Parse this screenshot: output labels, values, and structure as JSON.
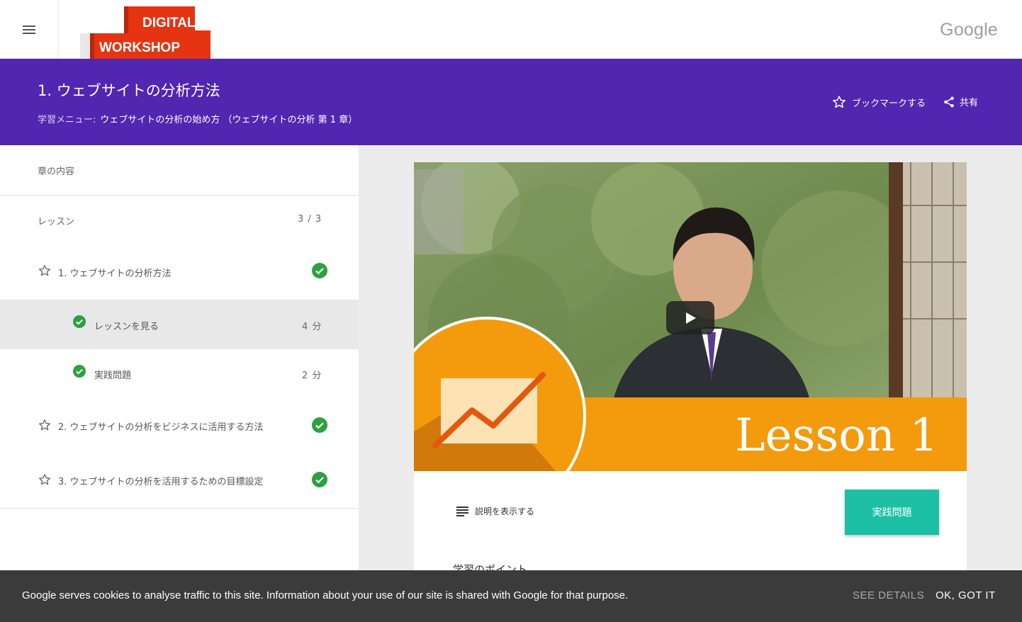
{
  "topbar": {
    "menu_icon": "hamburger-menu-icon",
    "logo_line1": "DIGITAL",
    "logo_line2": "WORKSHOP",
    "google_label": "Google"
  },
  "header": {
    "title": "1. ウェブサイトの分析方法",
    "sub_prefix": "学習メニュー:",
    "sub_value": "ウェブサイトの分析の始め方 （ウェブサイトの分析 第 1 章）",
    "bookmark_label": "ブックマークする",
    "share_label": "共有",
    "bg_color": "#5126b0"
  },
  "sidebar": {
    "heading": "章の内容",
    "lessons_label": "レッスン",
    "lessons_count": "3 / 3",
    "items": [
      {
        "label": "1. ウェブサイトの分析方法",
        "completed": true
      },
      {
        "label": "レッスンを見る",
        "minutes": "4 分",
        "completed": true,
        "active": true
      },
      {
        "label": "実践問題",
        "minutes": "2 分",
        "completed": true
      },
      {
        "label": "2. ウェブサイトの分析をビジネスに活用する方法",
        "completed": true
      },
      {
        "label": "3. ウェブサイトの分析を活用するための目標設定",
        "completed": true
      }
    ],
    "check_color": "#2ea043"
  },
  "video": {
    "lesson_label": "Lesson 1",
    "play_icon": "play-icon",
    "banner_color": "#f39a0d"
  },
  "content": {
    "description_label": "説明を表示する",
    "practice_button": "実践問題",
    "points_title": "学習のポイント",
    "accent_color": "#1dbfa5"
  },
  "cookie": {
    "text": "Google serves cookies to analyse traffic to this site. Information about your use of our site is shared with Google for that purpose.",
    "details_label": "SEE DETAILS",
    "ok_label": "OK, GOT IT"
  }
}
